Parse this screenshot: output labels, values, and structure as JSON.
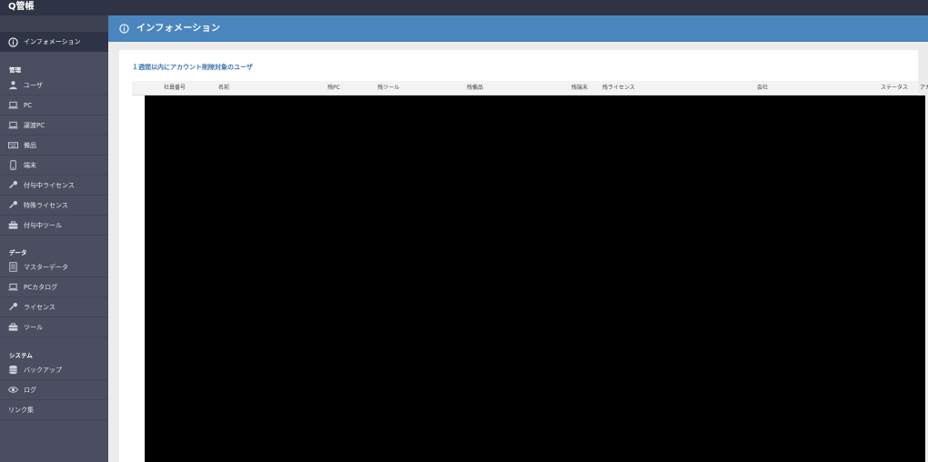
{
  "app": {
    "title": "Q管帳"
  },
  "sidebar": {
    "active": {
      "label": "インフォメーション",
      "icon": "info-icon"
    },
    "sections": [
      {
        "title": "管理",
        "items": [
          {
            "label": "ユーザ",
            "icon": "user-icon"
          },
          {
            "label": "PC",
            "icon": "laptop-icon"
          },
          {
            "label": "譲渡PC",
            "icon": "laptop-icon"
          },
          {
            "label": "備品",
            "icon": "keyboard-icon"
          },
          {
            "label": "端末",
            "icon": "phone-icon"
          },
          {
            "label": "付与中ライセンス",
            "icon": "key-icon"
          },
          {
            "label": "特殊ライセンス",
            "icon": "key-icon"
          },
          {
            "label": "付与中ツール",
            "icon": "toolbox-icon"
          }
        ]
      },
      {
        "title": "データ",
        "items": [
          {
            "label": "マスターデータ",
            "icon": "document-icon"
          },
          {
            "label": "PCカタログ",
            "icon": "laptop-icon"
          },
          {
            "label": "ライセンス",
            "icon": "key-icon"
          },
          {
            "label": "ツール",
            "icon": "toolbox-icon"
          }
        ]
      },
      {
        "title": "システム",
        "items": [
          {
            "label": "バックアップ",
            "icon": "database-icon"
          },
          {
            "label": "ログ",
            "icon": "eye-icon"
          },
          {
            "label": "リンク集",
            "icon": ""
          }
        ]
      }
    ]
  },
  "header": {
    "title": "インフォメーション",
    "icon": "info-icon"
  },
  "panel": {
    "title": "１週間以内にアカウント削除対象のユーザ",
    "columns": [
      "社員番号",
      "名前",
      "残PC",
      "残ツール",
      "残備品",
      "残端末",
      "残ライセンス",
      "会社",
      "ステータス",
      "アカ"
    ]
  },
  "colors": {
    "topbar": "#2f3346",
    "sidebar": "#4b4e60",
    "header": "#4a86bd",
    "panel_title": "#3d76ad"
  }
}
